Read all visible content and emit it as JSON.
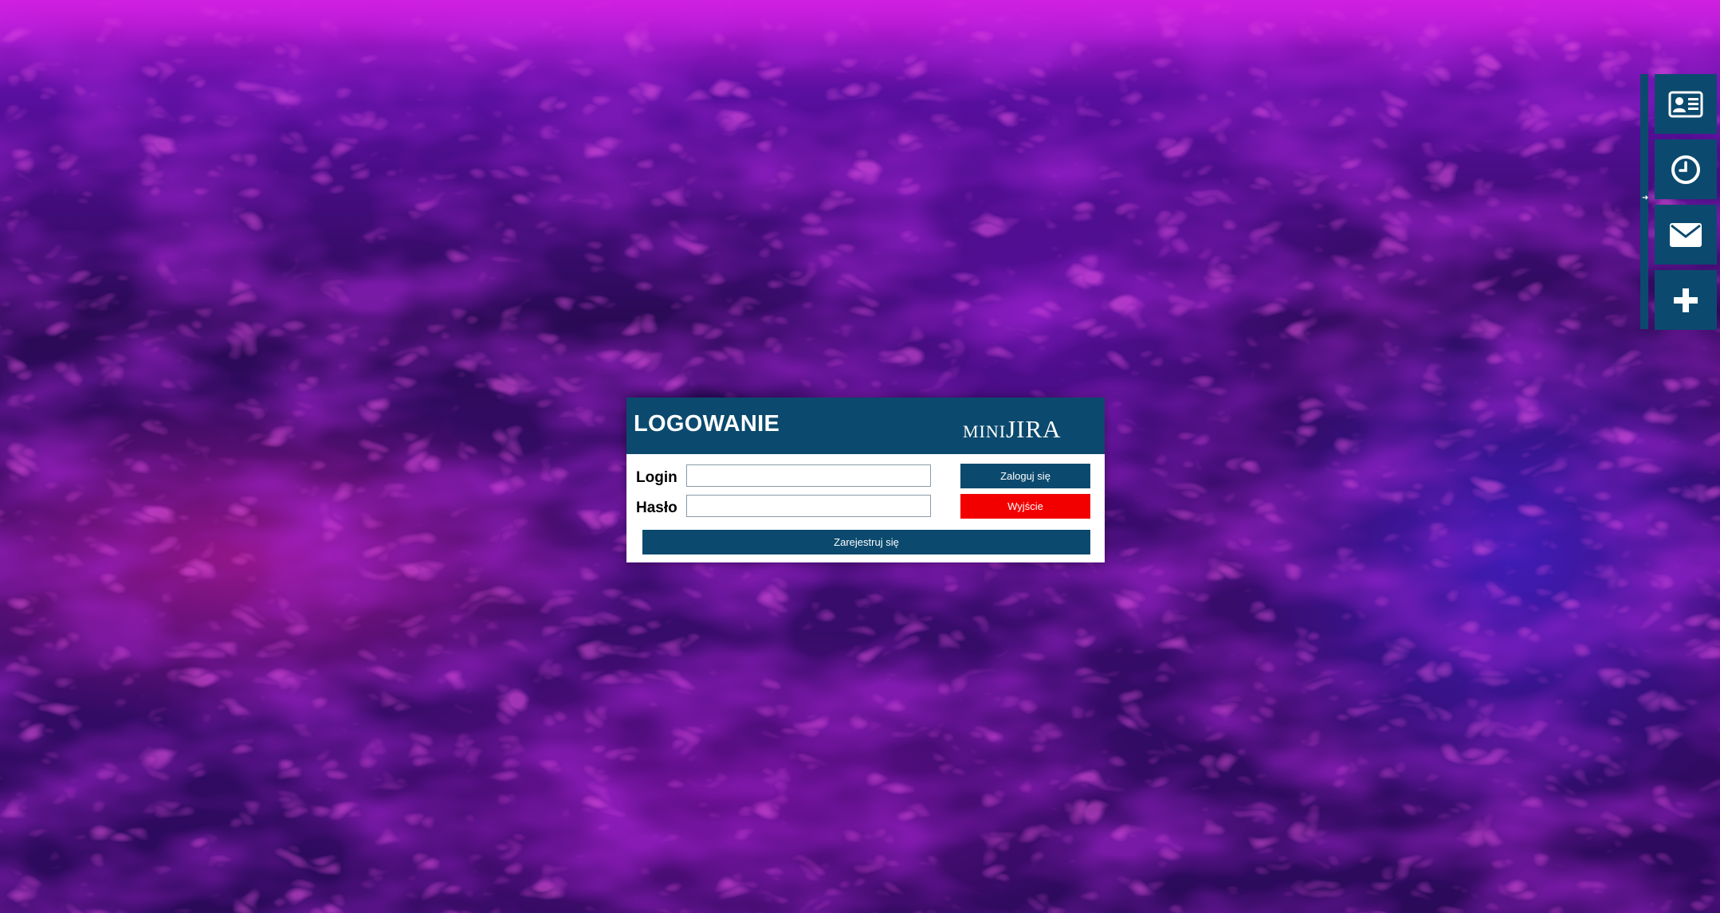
{
  "login_dialog": {
    "title": "LOGOWANIE",
    "brand": "miniJIRA",
    "login_label": "Login",
    "password_label": "Hasło",
    "login_value": "",
    "password_value": "",
    "login_button": "Zaloguj się",
    "exit_button": "Wyjście",
    "register_button": "Zarejestruj się"
  },
  "side_panel": {
    "items": [
      {
        "icon": "contact-card-icon"
      },
      {
        "icon": "clock-icon"
      },
      {
        "icon": "mail-icon"
      },
      {
        "icon": "plus-icon"
      }
    ],
    "handle_icon": "arrow-right-icon"
  },
  "colors": {
    "header": "#0b4a6e",
    "exit_button": "#f20000",
    "text_light": "#ffffff"
  }
}
